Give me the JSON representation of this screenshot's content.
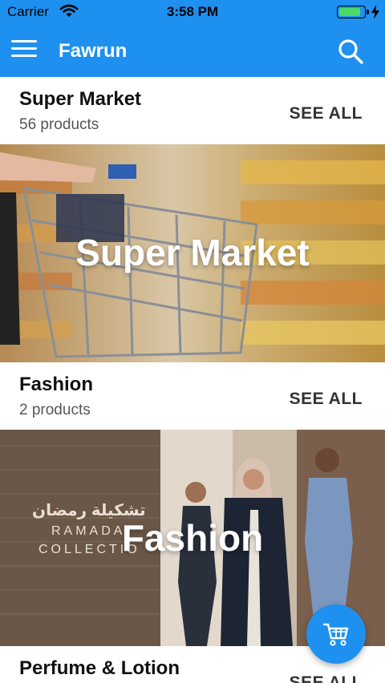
{
  "status_bar": {
    "carrier": "Carrier",
    "time": "3:58 PM",
    "battery_level": 0.85
  },
  "app_bar": {
    "title": "Fawrun"
  },
  "categories": [
    {
      "name": "Super Market",
      "count": "56 products",
      "see_all": "SEE ALL",
      "banner_label": "Super Market"
    },
    {
      "name": "Fashion",
      "count": "2 products",
      "see_all": "SEE ALL",
      "banner_label": "Fashion",
      "banner_text": {
        "arabic": "تشكيلة رمضان",
        "line1": "RAMADA",
        "line2": "COLLECTIO"
      }
    },
    {
      "name": "Perfume & Lotion",
      "see_all": "SEE ALL"
    }
  ],
  "colors": {
    "primary": "#1e90f0",
    "text_dark": "#111111",
    "text_muted": "#555555"
  }
}
